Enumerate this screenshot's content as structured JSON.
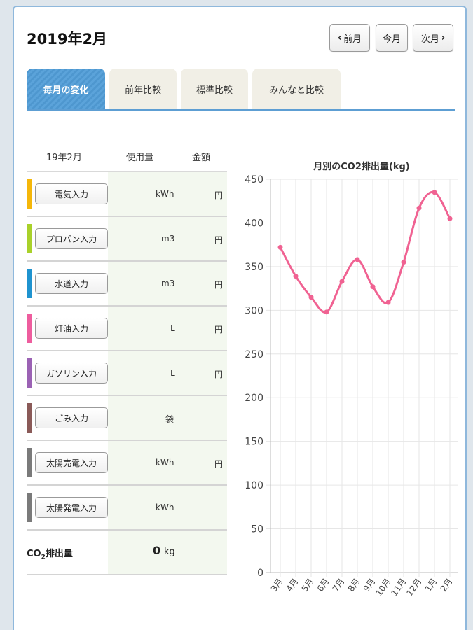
{
  "header": {
    "title": "2019年2月",
    "prev_label": "前月",
    "current_label": "今月",
    "next_label": "次月"
  },
  "tabs": [
    {
      "label": "毎月の変化",
      "active": true
    },
    {
      "label": "前年比較",
      "active": false
    },
    {
      "label": "標準比較",
      "active": false
    },
    {
      "label": "みんなと比較",
      "active": false
    }
  ],
  "table": {
    "headers": {
      "month": "19年2月",
      "usage": "使用量",
      "cost": "金額"
    },
    "rows": [
      {
        "button": "電気入力",
        "unit": "kWh",
        "yen": "円",
        "color": "#f5b70a"
      },
      {
        "button": "プロパン入力",
        "unit": "m3",
        "yen": "円",
        "color": "#a9d12a"
      },
      {
        "button": "水道入力",
        "unit": "m3",
        "yen": "円",
        "color": "#1f93cf"
      },
      {
        "button": "灯油入力",
        "unit": "L",
        "yen": "円",
        "color": "#ee5d9e"
      },
      {
        "button": "ガソリン入力",
        "unit": "L",
        "yen": "円",
        "color": "#9b62b4"
      },
      {
        "button": "ごみ入力",
        "unit": "袋",
        "yen": "",
        "color": "#8a5a58"
      },
      {
        "button": "太陽売電入力",
        "unit": "kWh",
        "yen": "円",
        "color": "#7a7a7a"
      },
      {
        "button": "太陽発電入力",
        "unit": "kWh",
        "yen": "",
        "color": "#7a7a7a"
      }
    ],
    "co2": {
      "label_pre": "CO",
      "label_sub": "2",
      "label_post": "排出量",
      "value": "0",
      "unit": "kg"
    }
  },
  "chart_data": {
    "type": "line",
    "title": "月別のCO2排出量(kg)",
    "categories": [
      "3月",
      "4月",
      "5月",
      "6月",
      "7月",
      "8月",
      "9月",
      "10月",
      "11月",
      "12月",
      "1月",
      "2月"
    ],
    "values": [
      372,
      339,
      315,
      298,
      333,
      358,
      327,
      309,
      355,
      417,
      435,
      405
    ],
    "ylim": [
      0,
      450
    ],
    "yticks": [
      "0",
      "50",
      "100",
      "150",
      "200",
      "250",
      "300",
      "350",
      "400",
      "450"
    ],
    "grid": true,
    "color": "#f06292"
  }
}
